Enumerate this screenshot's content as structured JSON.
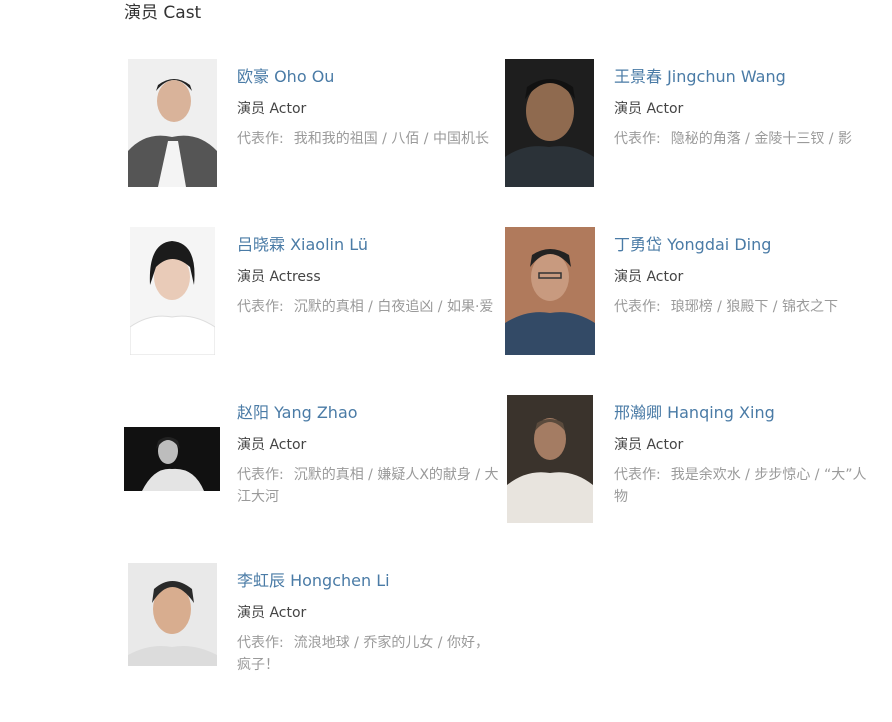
{
  "section": {
    "title": "演员 Cast"
  },
  "works_label": "代表作:",
  "cast": [
    {
      "name": "欧豪 Oho Ou",
      "role": "演员 Actor",
      "works": "我和我的祖国 / 八佰 / 中国机长"
    },
    {
      "name": "王景春 Jingchun Wang",
      "role": "演员 Actor",
      "works": "隐秘的角落 / 金陵十三钗 / 影"
    },
    {
      "name": "吕晓霖 Xiaolin Lü",
      "role": "演员 Actress",
      "works": "沉默的真相 / 白夜追凶 / 如果·爱"
    },
    {
      "name": "丁勇岱 Yongdai Ding",
      "role": "演员 Actor",
      "works": "琅琊榜 / 狼殿下 / 锦衣之下"
    },
    {
      "name": "赵阳 Yang Zhao",
      "role": "演员 Actor",
      "works": "沉默的真相 / 嫌疑人X的献身 / 大江大河"
    },
    {
      "name": "邢瀚卿 Hanqing Xing",
      "role": "演员 Actor",
      "works": "我是余欢水 / 步步惊心 / “大”人物"
    },
    {
      "name": "李虹辰 Hongchen Li",
      "role": "演员 Actor",
      "works": "流浪地球 / 乔家的儿女 / 你好，疯子！"
    }
  ]
}
